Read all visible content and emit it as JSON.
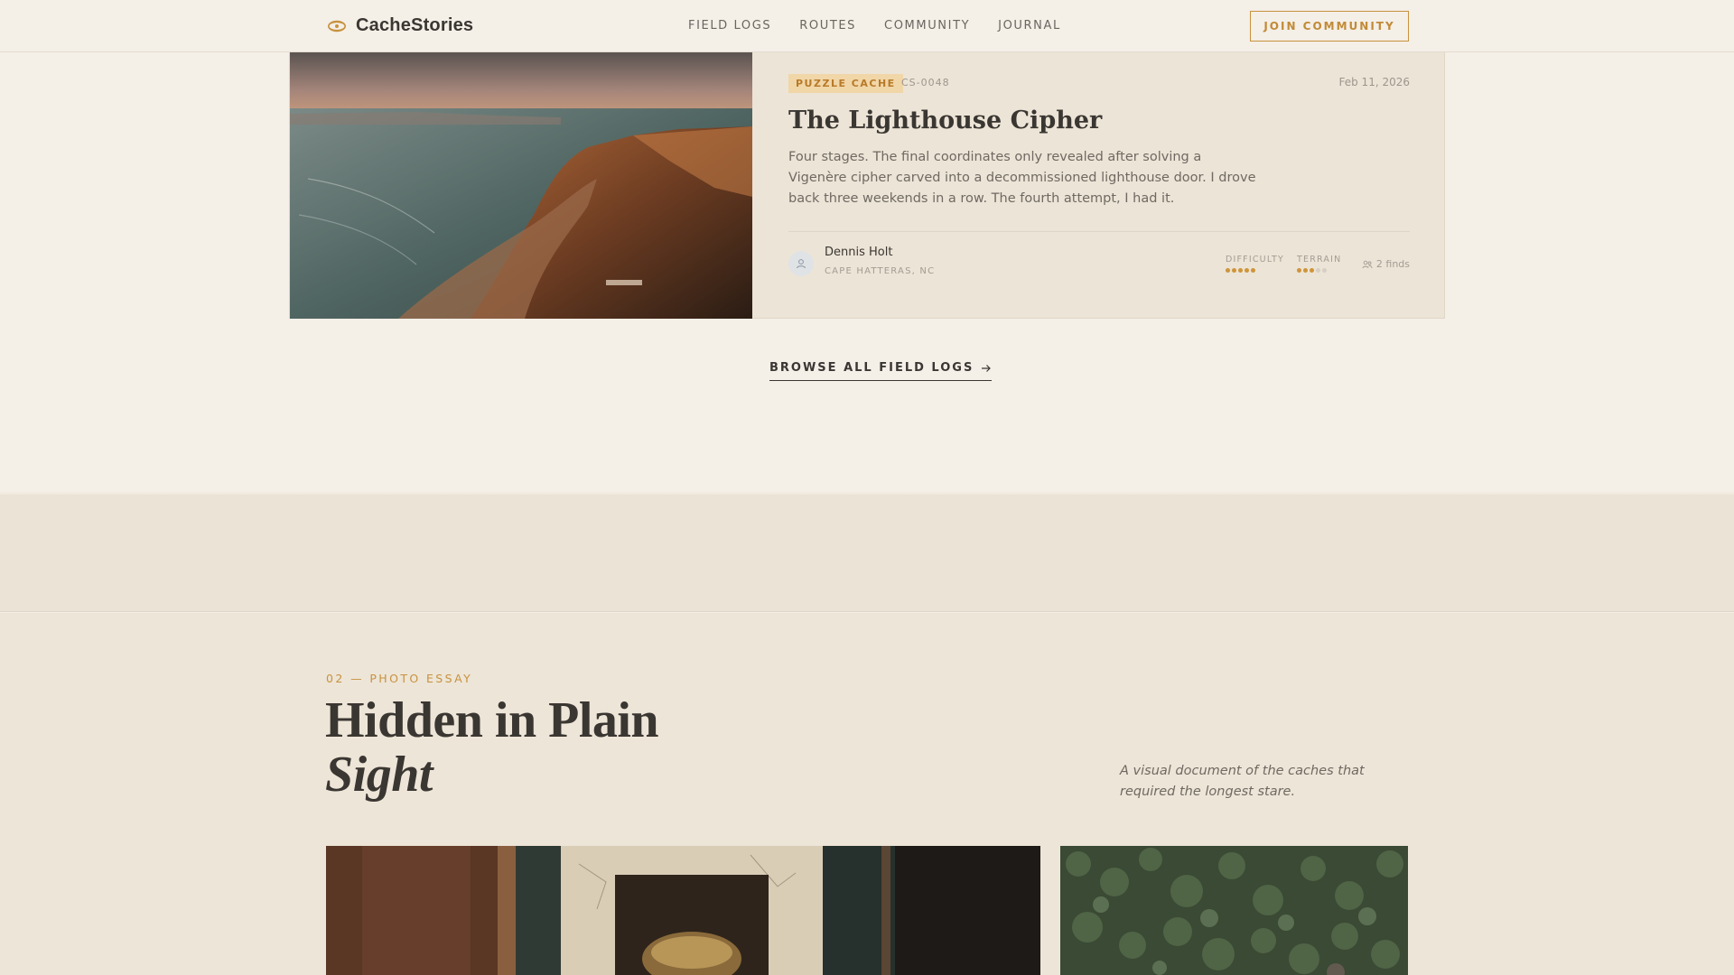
{
  "nav": {
    "brand": "CacheStories",
    "brand_icon": "compass-icon",
    "links": [
      "FIELD LOGS",
      "ROUTES",
      "COMMUNITY",
      "JOURNAL"
    ],
    "cta": "JOIN COMMUNITY"
  },
  "feature": {
    "tag": "PUZZLE CACHE",
    "code": "CS-0048",
    "date": "Feb 11, 2026",
    "title": "The Lighthouse Cipher",
    "description": "Four stages. The final coordinates only revealed after solving a Vigenère cipher carved into a decommissioned lighthouse door. I drove back three weekends in a row. The fourth attempt, I had it.",
    "author": {
      "name": "Dennis Holt",
      "location": "CAPE HATTERAS, NC"
    },
    "difficulty": {
      "label": "DIFFICULTY",
      "value": 5,
      "max": 5
    },
    "terrain": {
      "label": "TERRAIN",
      "value": 3,
      "max": 5
    },
    "finds": "2 finds",
    "accent": "#cf943a"
  },
  "browse": {
    "label": "BROWSE ALL FIELD LOGS"
  },
  "essay": {
    "eyebrow": "02 — PHOTO ESSAY",
    "title_line1": "Hidden in Plain",
    "title_line2": "Sight",
    "caption": "A visual document of the caches that required the longest stare."
  }
}
